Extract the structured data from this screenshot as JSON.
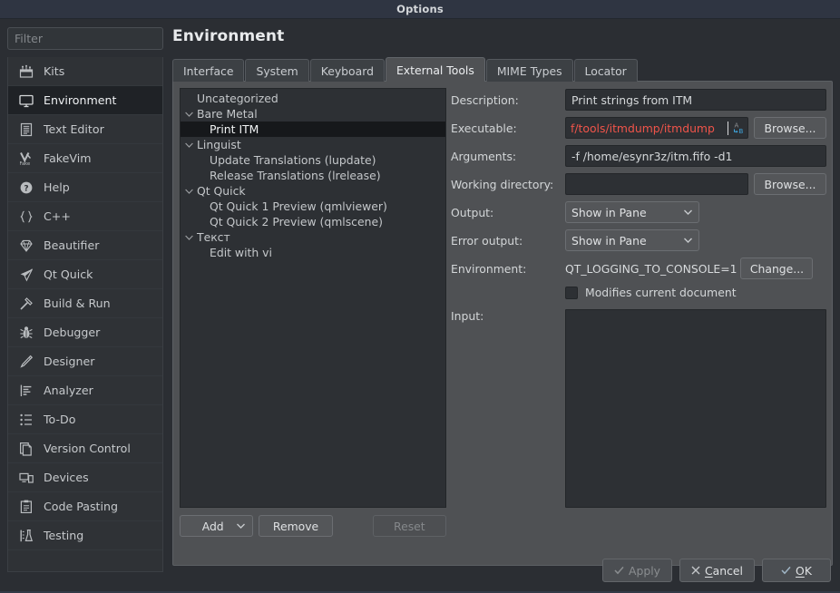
{
  "window": {
    "title": "Options"
  },
  "sidebar": {
    "filter_placeholder": "Filter",
    "filter_value": "",
    "items": [
      {
        "label": "Kits",
        "icon": "kits-icon",
        "selected": false
      },
      {
        "label": "Environment",
        "icon": "monitor-icon",
        "selected": true
      },
      {
        "label": "Text Editor",
        "icon": "text-document-icon",
        "selected": false
      },
      {
        "label": "FakeVim",
        "icon": "fakevim-icon",
        "selected": false
      },
      {
        "label": "Help",
        "icon": "question-mark-icon",
        "selected": false
      },
      {
        "label": "C++",
        "icon": "braces-icon",
        "selected": false
      },
      {
        "label": "Beautifier",
        "icon": "diamond-icon",
        "selected": false
      },
      {
        "label": "Qt Quick",
        "icon": "paper-plane-icon",
        "selected": false
      },
      {
        "label": "Build & Run",
        "icon": "hammer-icon",
        "selected": false
      },
      {
        "label": "Debugger",
        "icon": "bug-icon",
        "selected": false
      },
      {
        "label": "Designer",
        "icon": "pencil-icon",
        "selected": false
      },
      {
        "label": "Analyzer",
        "icon": "analyzer-chart-icon",
        "selected": false
      },
      {
        "label": "To-Do",
        "icon": "checklist-icon",
        "selected": false
      },
      {
        "label": "Version Control",
        "icon": "copy-pages-icon",
        "selected": false
      },
      {
        "label": "Devices",
        "icon": "devices-icon",
        "selected": false
      },
      {
        "label": "Code Pasting",
        "icon": "clipboard-icon",
        "selected": false
      },
      {
        "label": "Testing",
        "icon": "flask-icon",
        "selected": false
      }
    ]
  },
  "page": {
    "title": "Environment"
  },
  "tabs": [
    {
      "label": "Interface",
      "active": false
    },
    {
      "label": "System",
      "active": false
    },
    {
      "label": "Keyboard",
      "active": false
    },
    {
      "label": "External Tools",
      "active": true
    },
    {
      "label": "MIME Types",
      "active": false
    },
    {
      "label": "Locator",
      "active": false
    }
  ],
  "tools_tree": [
    {
      "label": "Uncategorized",
      "level": 0,
      "expandable": false,
      "expanded": false,
      "selected": false
    },
    {
      "label": "Bare Metal",
      "level": 0,
      "expandable": true,
      "expanded": true,
      "selected": false
    },
    {
      "label": "Print ITM",
      "level": 1,
      "expandable": false,
      "expanded": false,
      "selected": true
    },
    {
      "label": "Linguist",
      "level": 0,
      "expandable": true,
      "expanded": true,
      "selected": false
    },
    {
      "label": "Update Translations (lupdate)",
      "level": 1,
      "expandable": false,
      "expanded": false,
      "selected": false
    },
    {
      "label": "Release Translations (lrelease)",
      "level": 1,
      "expandable": false,
      "expanded": false,
      "selected": false
    },
    {
      "label": "Qt Quick",
      "level": 0,
      "expandable": true,
      "expanded": true,
      "selected": false
    },
    {
      "label": "Qt Quick 1 Preview (qmlviewer)",
      "level": 1,
      "expandable": false,
      "expanded": false,
      "selected": false
    },
    {
      "label": "Qt Quick 2 Preview (qmlscene)",
      "level": 1,
      "expandable": false,
      "expanded": false,
      "selected": false
    },
    {
      "label": "Текст",
      "level": 0,
      "expandable": true,
      "expanded": true,
      "selected": false
    },
    {
      "label": "Edit with vi",
      "level": 1,
      "expandable": false,
      "expanded": false,
      "selected": false
    }
  ],
  "tree_buttons": {
    "add": "Add",
    "remove": "Remove",
    "reset": "Reset"
  },
  "form": {
    "description_label": "Description:",
    "description_value": "Print strings from ITM",
    "executable_label": "Executable:",
    "executable_value": "f/tools/itmdump/itmdump",
    "executable_browse": "Browse...",
    "arguments_label": "Arguments:",
    "arguments_value": "-f /home/esynr3z/itm.fifo -d1",
    "working_directory_label": "Working directory:",
    "working_directory_value": "",
    "working_directory_browse": "Browse...",
    "output_label": "Output:",
    "output_value": "Show in Pane",
    "error_output_label": "Error output:",
    "error_output_value": "Show in Pane",
    "environment_label": "Environment:",
    "environment_value": "QT_LOGGING_TO_CONSOLE=1",
    "environment_change": "Change...",
    "modifies_label": "Modifies current document",
    "modifies_checked": false,
    "input_label": "Input:",
    "input_value": ""
  },
  "dialog_buttons": {
    "apply": "Apply",
    "cancel": "Cancel",
    "ok": "OK"
  },
  "colors": {
    "accent_invalid": "#f0544a",
    "title_bar": "#2f3542",
    "panel": "#4f5154",
    "selection": "#16181b",
    "var_icon_blue": "#3fa7e0"
  }
}
